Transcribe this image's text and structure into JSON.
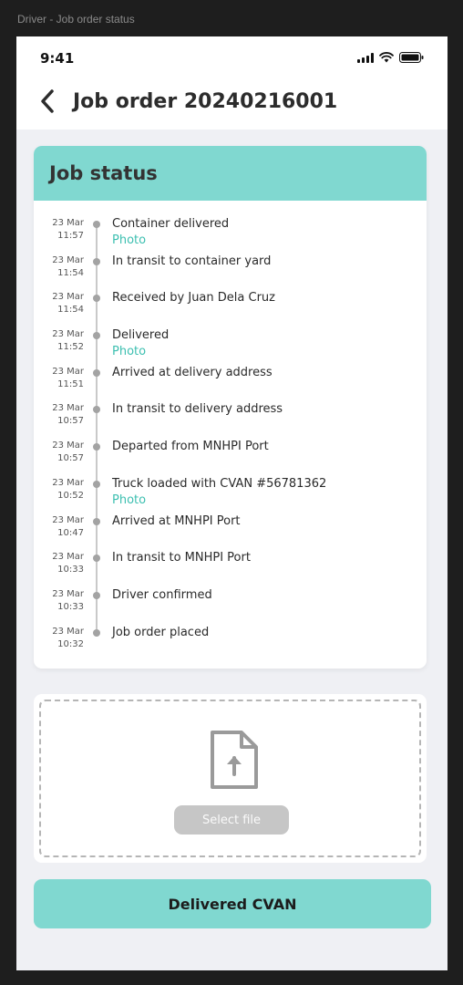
{
  "frame_label": "Driver - Job order status",
  "status_bar": {
    "time": "9:41"
  },
  "header": {
    "title": "Job order 20240216001"
  },
  "job_status": {
    "title": "Job status",
    "events": [
      {
        "date": "23 Mar",
        "time": "11:57",
        "label": "Container delivered",
        "link": "Photo"
      },
      {
        "date": "23 Mar",
        "time": "11:54",
        "label": "In transit to container yard"
      },
      {
        "date": "23 Mar",
        "time": "11:54",
        "label": "Received by Juan Dela Cruz"
      },
      {
        "date": "23 Mar",
        "time": "11:52",
        "label": "Delivered",
        "link": "Photo"
      },
      {
        "date": "23 Mar",
        "time": "11:51",
        "label": "Arrived at delivery address"
      },
      {
        "date": "23 Mar",
        "time": "10:57",
        "label": "In transit to delivery address"
      },
      {
        "date": "23 Mar",
        "time": "10:57",
        "label": "Departed from MNHPI Port"
      },
      {
        "date": "23 Mar",
        "time": "10:52",
        "label": "Truck loaded with CVAN #56781362",
        "link": "Photo"
      },
      {
        "date": "23 Mar",
        "time": "10:47",
        "label": "Arrived at MNHPI Port"
      },
      {
        "date": "23 Mar",
        "time": "10:33",
        "label": "In transit to MNHPI Port"
      },
      {
        "date": "23 Mar",
        "time": "10:33",
        "label": "Driver confirmed"
      },
      {
        "date": "23 Mar",
        "time": "10:32",
        "label": "Job order placed"
      }
    ]
  },
  "upload": {
    "select_label": "Select file"
  },
  "actions": {
    "primary_label": "Delivered CVAN"
  },
  "colors": {
    "accent": "#80d8d0",
    "link": "#3cbfb0",
    "background": "#eff0f4"
  }
}
